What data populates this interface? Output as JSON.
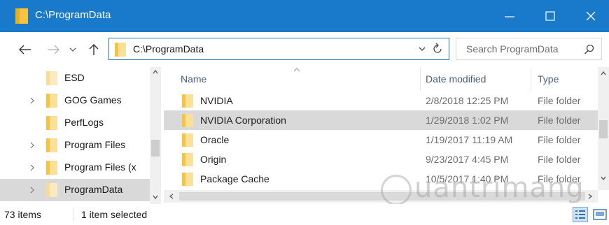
{
  "window": {
    "title": "C:\\ProgramData",
    "titlebar_color": "#1979ca",
    "buttons": [
      "minimize-icon",
      "maximize-icon",
      "close-icon"
    ]
  },
  "address": {
    "path": "C:\\ProgramData",
    "search_placeholder": "Search ProgramData"
  },
  "nav": {
    "items": [
      {
        "label": "ESD",
        "expandable": false,
        "selected": false
      },
      {
        "label": "GOG Games",
        "expandable": true,
        "selected": false
      },
      {
        "label": "PerfLogs",
        "expandable": false,
        "selected": false
      },
      {
        "label": "Program Files",
        "expandable": true,
        "selected": false
      },
      {
        "label": "Program Files (x",
        "expandable": true,
        "selected": false
      },
      {
        "label": "ProgramData",
        "expandable": true,
        "selected": true
      }
    ]
  },
  "columns": {
    "name": "Name",
    "date": "Date modified",
    "type": "Type"
  },
  "files": [
    {
      "name": "NVIDIA",
      "date": "2/8/2018 12:25 PM",
      "type": "File folder",
      "selected": false
    },
    {
      "name": "NVIDIA Corporation",
      "date": "1/29/2018 1:02 PM",
      "type": "File folder",
      "selected": true
    },
    {
      "name": "Oracle",
      "date": "1/19/2017 11:19 AM",
      "type": "File folder",
      "selected": false
    },
    {
      "name": "Origin",
      "date": "9/23/2017 4:45 PM",
      "type": "File folder",
      "selected": false
    },
    {
      "name": "Package Cache",
      "date": "10/5/2017 1:40 PM",
      "type": "File folder",
      "selected": false
    }
  ],
  "status": {
    "item_count": "73 items",
    "selection": "1 item selected"
  },
  "colors": {
    "folder": "#f6c343",
    "folder_light": "#fbe09a",
    "selection": "#d9d9d9",
    "accent": "#1979ca"
  }
}
